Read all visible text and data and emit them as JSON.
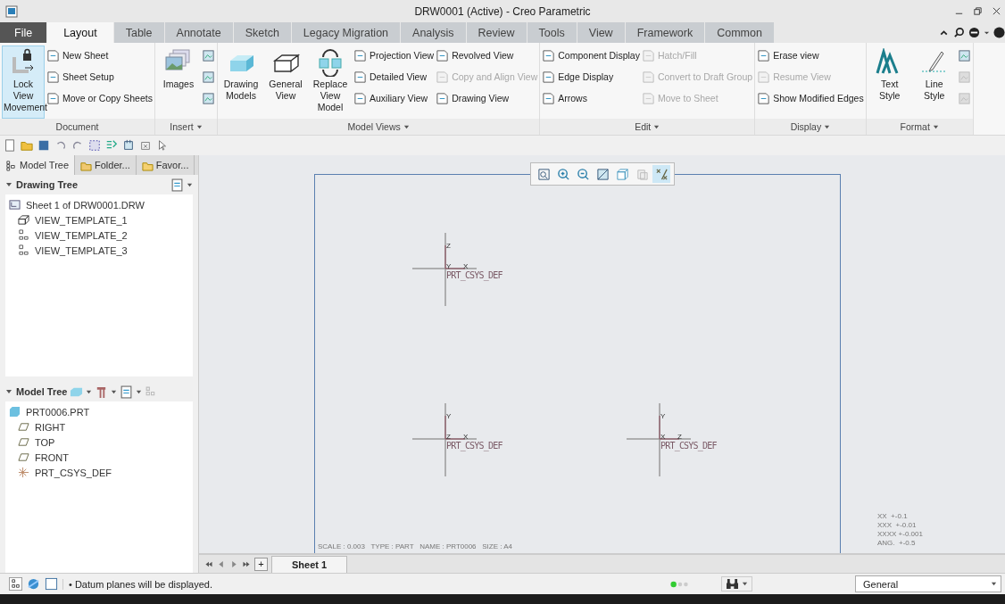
{
  "window": {
    "title": "DRW0001 (Active) - Creo Parametric"
  },
  "tabs": [
    {
      "label": "File",
      "kind": "file",
      "selected": false
    },
    {
      "label": "Layout",
      "kind": "tab",
      "selected": true
    },
    {
      "label": "Table",
      "kind": "tab",
      "selected": false
    },
    {
      "label": "Annotate",
      "kind": "tab",
      "selected": false
    },
    {
      "label": "Sketch",
      "kind": "tab",
      "selected": false
    },
    {
      "label": "Legacy Migration",
      "kind": "tab",
      "selected": false
    },
    {
      "label": "Analysis",
      "kind": "tab",
      "selected": false
    },
    {
      "label": "Review",
      "kind": "tab",
      "selected": false
    },
    {
      "label": "Tools",
      "kind": "tab",
      "selected": false
    },
    {
      "label": "View",
      "kind": "tab",
      "selected": false
    },
    {
      "label": "Framework",
      "kind": "tab",
      "selected": false
    },
    {
      "label": "Common",
      "kind": "tab",
      "selected": false
    }
  ],
  "ribbon": [
    {
      "label": "Document",
      "menu": false,
      "large": [
        {
          "label": "Lock View Movement",
          "on": true
        }
      ],
      "columns": [
        [
          {
            "label": "New Sheet",
            "disabled": false
          },
          {
            "label": "Sheet Setup",
            "disabled": false
          },
          {
            "label": "Move or Copy Sheets",
            "disabled": false
          }
        ]
      ]
    },
    {
      "label": "Insert",
      "menu": true,
      "large": [
        {
          "label": "Images",
          "on": false
        }
      ],
      "columns": [
        [
          {
            "disabled": false
          },
          {
            "disabled": false
          },
          {
            "disabled": false
          }
        ]
      ]
    },
    {
      "label": "Model Views",
      "menu": true,
      "large": [
        {
          "label": "Drawing Models",
          "on": false
        },
        {
          "label": "General View",
          "on": false
        },
        {
          "label": "Replace View Model",
          "on": false
        }
      ],
      "columns": [
        [
          {
            "label": "Projection View",
            "disabled": false
          },
          {
            "label": "Detailed View",
            "disabled": false
          },
          {
            "label": "Auxiliary View",
            "disabled": false
          }
        ],
        [
          {
            "label": "Revolved View",
            "disabled": false
          },
          {
            "label": "Copy and Align View",
            "disabled": true
          },
          {
            "label": "Drawing View",
            "disabled": false
          }
        ]
      ]
    },
    {
      "label": "Edit",
      "menu": true,
      "columns": [
        [
          {
            "label": "Component Display",
            "disabled": false
          },
          {
            "label": "Edge Display",
            "disabled": false
          },
          {
            "label": "Arrows",
            "disabled": false
          }
        ],
        [
          {
            "label": "Hatch/Fill",
            "disabled": true
          },
          {
            "label": "Convert to Draft Group",
            "disabled": true
          },
          {
            "label": "Move to Sheet",
            "disabled": true
          }
        ]
      ]
    },
    {
      "label": "Display",
      "menu": true,
      "columns": [
        [
          {
            "label": "Erase view",
            "disabled": false
          },
          {
            "label": "Resume View",
            "disabled": true
          },
          {
            "label": "Show Modified Edges",
            "disabled": false
          }
        ]
      ]
    },
    {
      "label": "Format",
      "menu": true,
      "large": [
        {
          "label": "Text Style",
          "on": false
        },
        {
          "label": "Line Style",
          "on": false
        }
      ],
      "columns": [
        [
          {
            "disabled": false
          },
          {
            "disabled": true
          },
          {
            "disabled": true
          }
        ]
      ]
    }
  ],
  "panel": {
    "tabs": [
      {
        "label": "Model Tree",
        "selected": true
      },
      {
        "label": "Folder...",
        "selected": false
      },
      {
        "label": "Favor...",
        "selected": false
      }
    ],
    "drawing_tree": {
      "title": "Drawing Tree",
      "expanded": true,
      "items": [
        {
          "label": "Sheet 1 of DRW0001.DRW",
          "kind": "sheet",
          "children": [
            {
              "label": "VIEW_TEMPLATE_1",
              "kind": "general"
            },
            {
              "label": "VIEW_TEMPLATE_2",
              "kind": "projection"
            },
            {
              "label": "VIEW_TEMPLATE_3",
              "kind": "projection"
            }
          ]
        }
      ]
    },
    "model_tree": {
      "title": "Model Tree",
      "expanded": true,
      "items": [
        {
          "label": "PRT0006.PRT",
          "kind": "part",
          "children": [
            {
              "label": "RIGHT",
              "kind": "plane"
            },
            {
              "label": "TOP",
              "kind": "plane"
            },
            {
              "label": "FRONT",
              "kind": "plane"
            },
            {
              "label": "PRT_CSYS_DEF",
              "kind": "csys"
            }
          ]
        }
      ]
    }
  },
  "canvas": {
    "view_toolbar": [
      {
        "selected": false
      },
      {
        "selected": false
      },
      {
        "selected": false
      },
      {
        "selected": false
      },
      {
        "selected": false
      },
      {
        "selected": false
      },
      {
        "selected": true
      }
    ],
    "views": [
      {
        "label": "PRT_CSYS_DEF",
        "axes": [
          "Z",
          "Y",
          "X"
        ]
      },
      {
        "label": "PRT_CSYS_DEF",
        "axes": [
          "Y",
          "Z",
          "X"
        ]
      },
      {
        "label": "PRT_CSYS_DEF",
        "axes": [
          "Y",
          "X",
          "Z"
        ]
      }
    ],
    "title_block": "SCALE : 0.003   TYPE : PART   NAME : PRT0006   SIZE : A4",
    "tolerances": [
      "XX  +-0.1",
      "XXX  +-0.01",
      "XXXX +-0.001",
      "ANG.  +-0.5"
    ]
  },
  "sheet_tabs": {
    "add": "+",
    "sheets": [
      {
        "label": "Sheet 1",
        "selected": true
      }
    ]
  },
  "status": {
    "message": "• Datum planes will be displayed.",
    "filter": "General"
  }
}
